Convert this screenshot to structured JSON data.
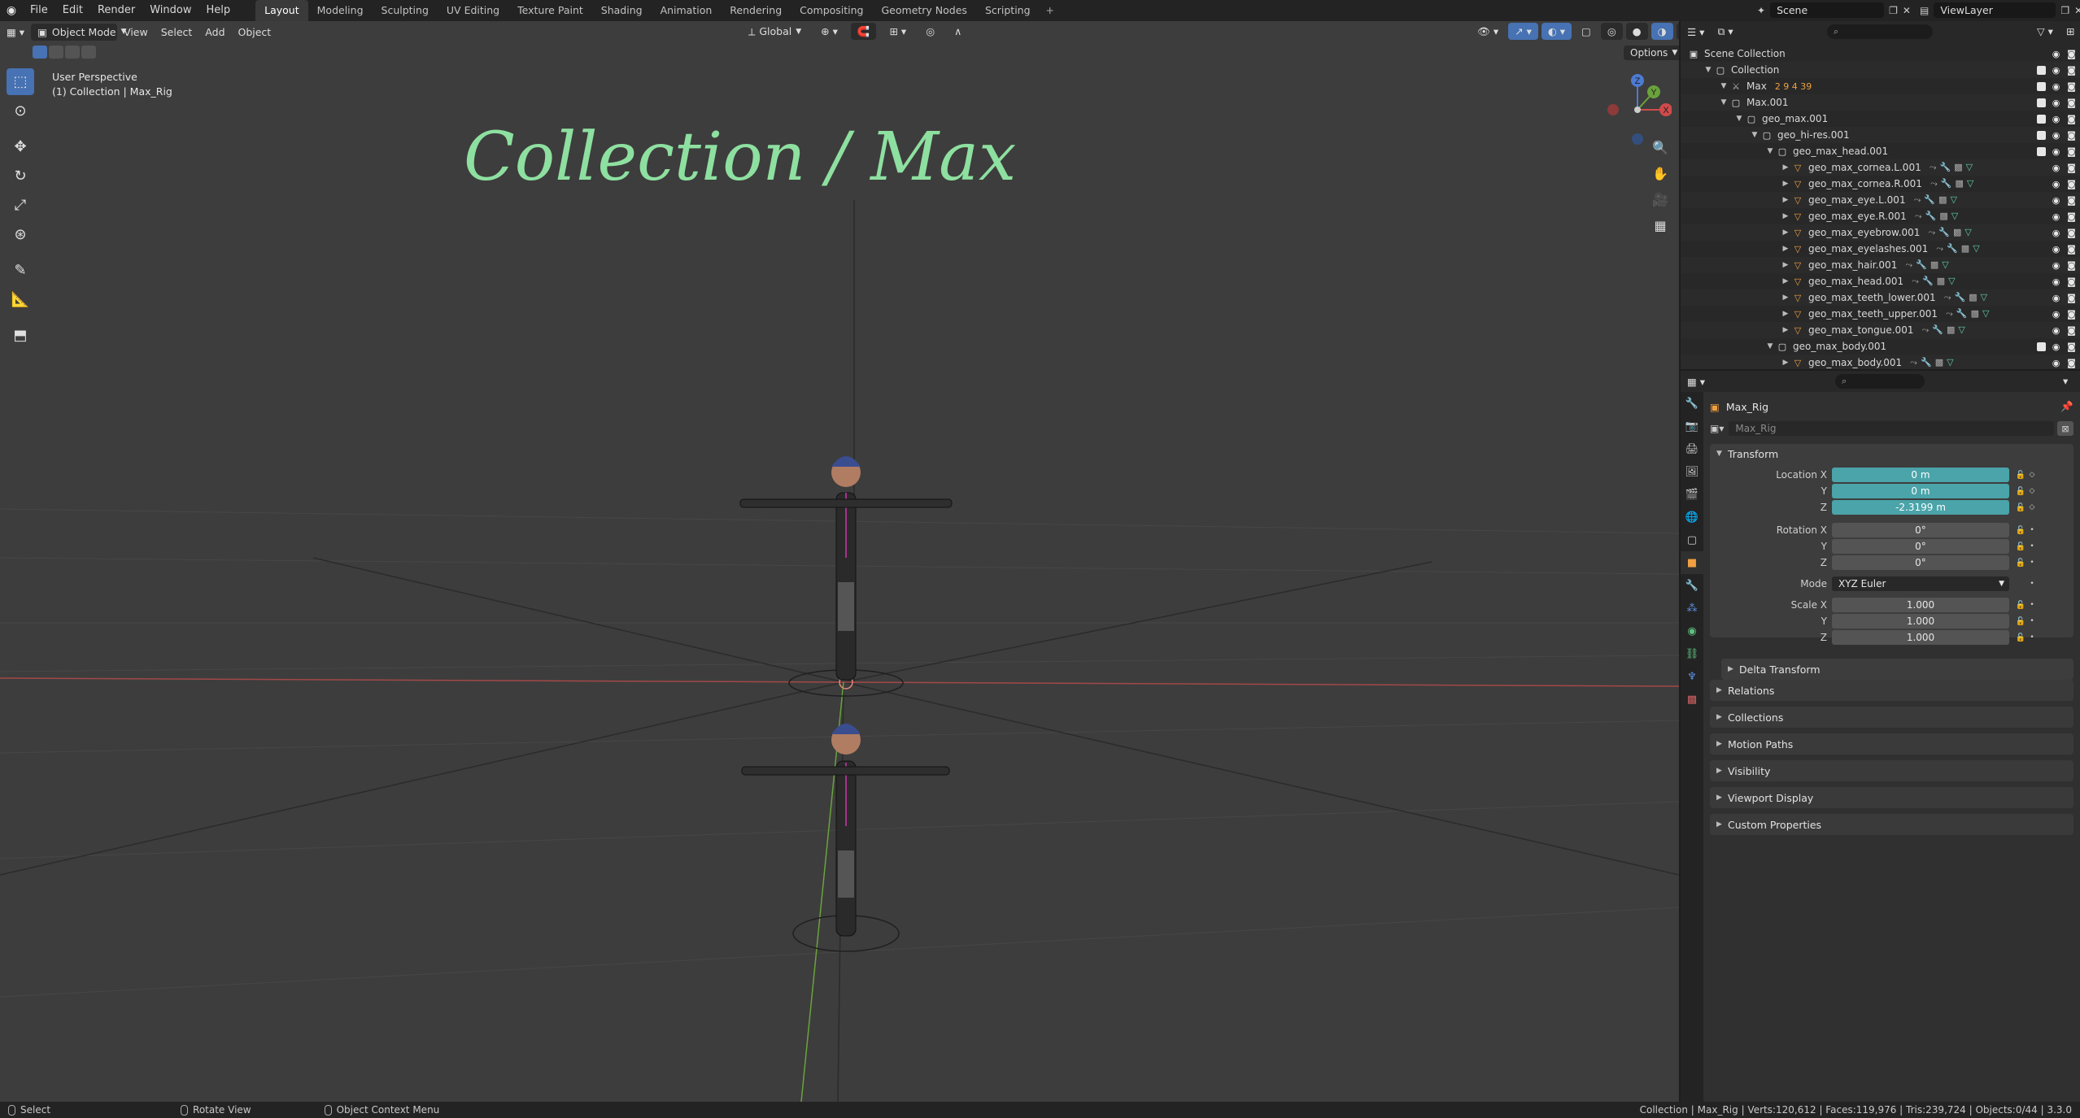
{
  "menu": [
    "File",
    "Edit",
    "Render",
    "Window",
    "Help"
  ],
  "workspaces": [
    {
      "label": "Layout",
      "active": true
    },
    {
      "label": "Modeling"
    },
    {
      "label": "Sculpting"
    },
    {
      "label": "UV Editing"
    },
    {
      "label": "Texture Paint"
    },
    {
      "label": "Shading"
    },
    {
      "label": "Animation"
    },
    {
      "label": "Rendering"
    },
    {
      "label": "Compositing"
    },
    {
      "label": "Geometry Nodes"
    },
    {
      "label": "Scripting"
    }
  ],
  "scene_name": "Scene",
  "view_layer": "ViewLayer",
  "viewport": {
    "mode": "Object Mode",
    "menus": [
      "View",
      "Select",
      "Add",
      "Object"
    ],
    "orientation": "Global",
    "options": "Options",
    "perspective": "User Perspective",
    "active_label": "(1) Collection | Max_Rig",
    "annotation": "Collection / Max",
    "gizmo_axes": {
      "x": "X",
      "y": "Y",
      "z": "Z"
    },
    "accent": "#4772b3"
  },
  "outliner": {
    "rows": [
      {
        "label": "Scene Collection",
        "depth": 0
      },
      {
        "label": "Collection",
        "depth": 1
      },
      {
        "label": "Max",
        "depth": 2
      },
      {
        "label": "Max.001",
        "depth": 2
      },
      {
        "label": "geo_max.001",
        "depth": 3
      },
      {
        "label": "geo_hi-res.001",
        "depth": 4
      },
      {
        "label": "geo_max_head.001",
        "depth": 5
      },
      {
        "label": "geo_max_cornea.L.001",
        "depth": 6
      },
      {
        "label": "geo_max_cornea.R.001",
        "depth": 6
      },
      {
        "label": "geo_max_eye.L.001",
        "depth": 6
      },
      {
        "label": "geo_max_eye.R.001",
        "depth": 6
      },
      {
        "label": "geo_max_eyebrow.001",
        "depth": 6
      },
      {
        "label": "geo_max_eyelashes.001",
        "depth": 6
      },
      {
        "label": "geo_max_hair.001",
        "depth": 6
      },
      {
        "label": "geo_max_head.001",
        "depth": 6
      },
      {
        "label": "geo_max_teeth_lower.001",
        "depth": 6
      },
      {
        "label": "geo_max_teeth_upper.001",
        "depth": 6
      },
      {
        "label": "geo_max_tongue.001",
        "depth": 6
      },
      {
        "label": "geo_max_body.001",
        "depth": 5
      },
      {
        "label": "geo_max_body.001",
        "depth": 6
      }
    ],
    "max_badge": "2 9 4 39"
  },
  "properties": {
    "object_name": "Max_Rig",
    "data_name": "Max_Rig",
    "transform": {
      "title": "Transform",
      "location_label": "Location X",
      "location": [
        "0 m",
        "0 m",
        "-2.3199 m"
      ],
      "rotation_label": "Rotation X",
      "rotation": [
        "0°",
        "0°",
        "0°"
      ],
      "mode_label": "Mode",
      "mode": "XYZ Euler",
      "scale_label": "Scale X",
      "scale": [
        "1.000",
        "1.000",
        "1.000"
      ],
      "y": "Y",
      "z": "Z"
    },
    "delta": "Delta Transform",
    "panels": [
      "Relations",
      "Collections",
      "Motion Paths",
      "Visibility",
      "Viewport Display",
      "Custom Properties"
    ]
  },
  "status": {
    "select": "Select",
    "rotate": "Rotate View",
    "context": "Object Context Menu",
    "stats": "Collection | Max_Rig | Verts:120,612 | Faces:119,976 | Tris:239,724 | Objects:0/44 | 3.3.0"
  }
}
